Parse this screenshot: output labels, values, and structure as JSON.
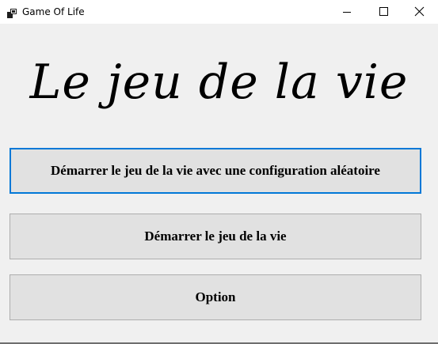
{
  "window": {
    "title": "Game Of Life",
    "icon": "app-icon",
    "controls": {
      "minimize_icon": "minimize-icon",
      "maximize_icon": "maximize-icon",
      "close_icon": "close-icon"
    }
  },
  "main": {
    "heading": "Le jeu de la vie",
    "buttons": {
      "random_start": "Démarrer le jeu de la vie avec une configuration aléatoire",
      "start": "Démarrer le jeu de la vie",
      "option": "Option"
    }
  },
  "colors": {
    "focus_border": "#0078d7",
    "button_face": "#e1e1e1",
    "window_background": "#f0f0f0"
  }
}
